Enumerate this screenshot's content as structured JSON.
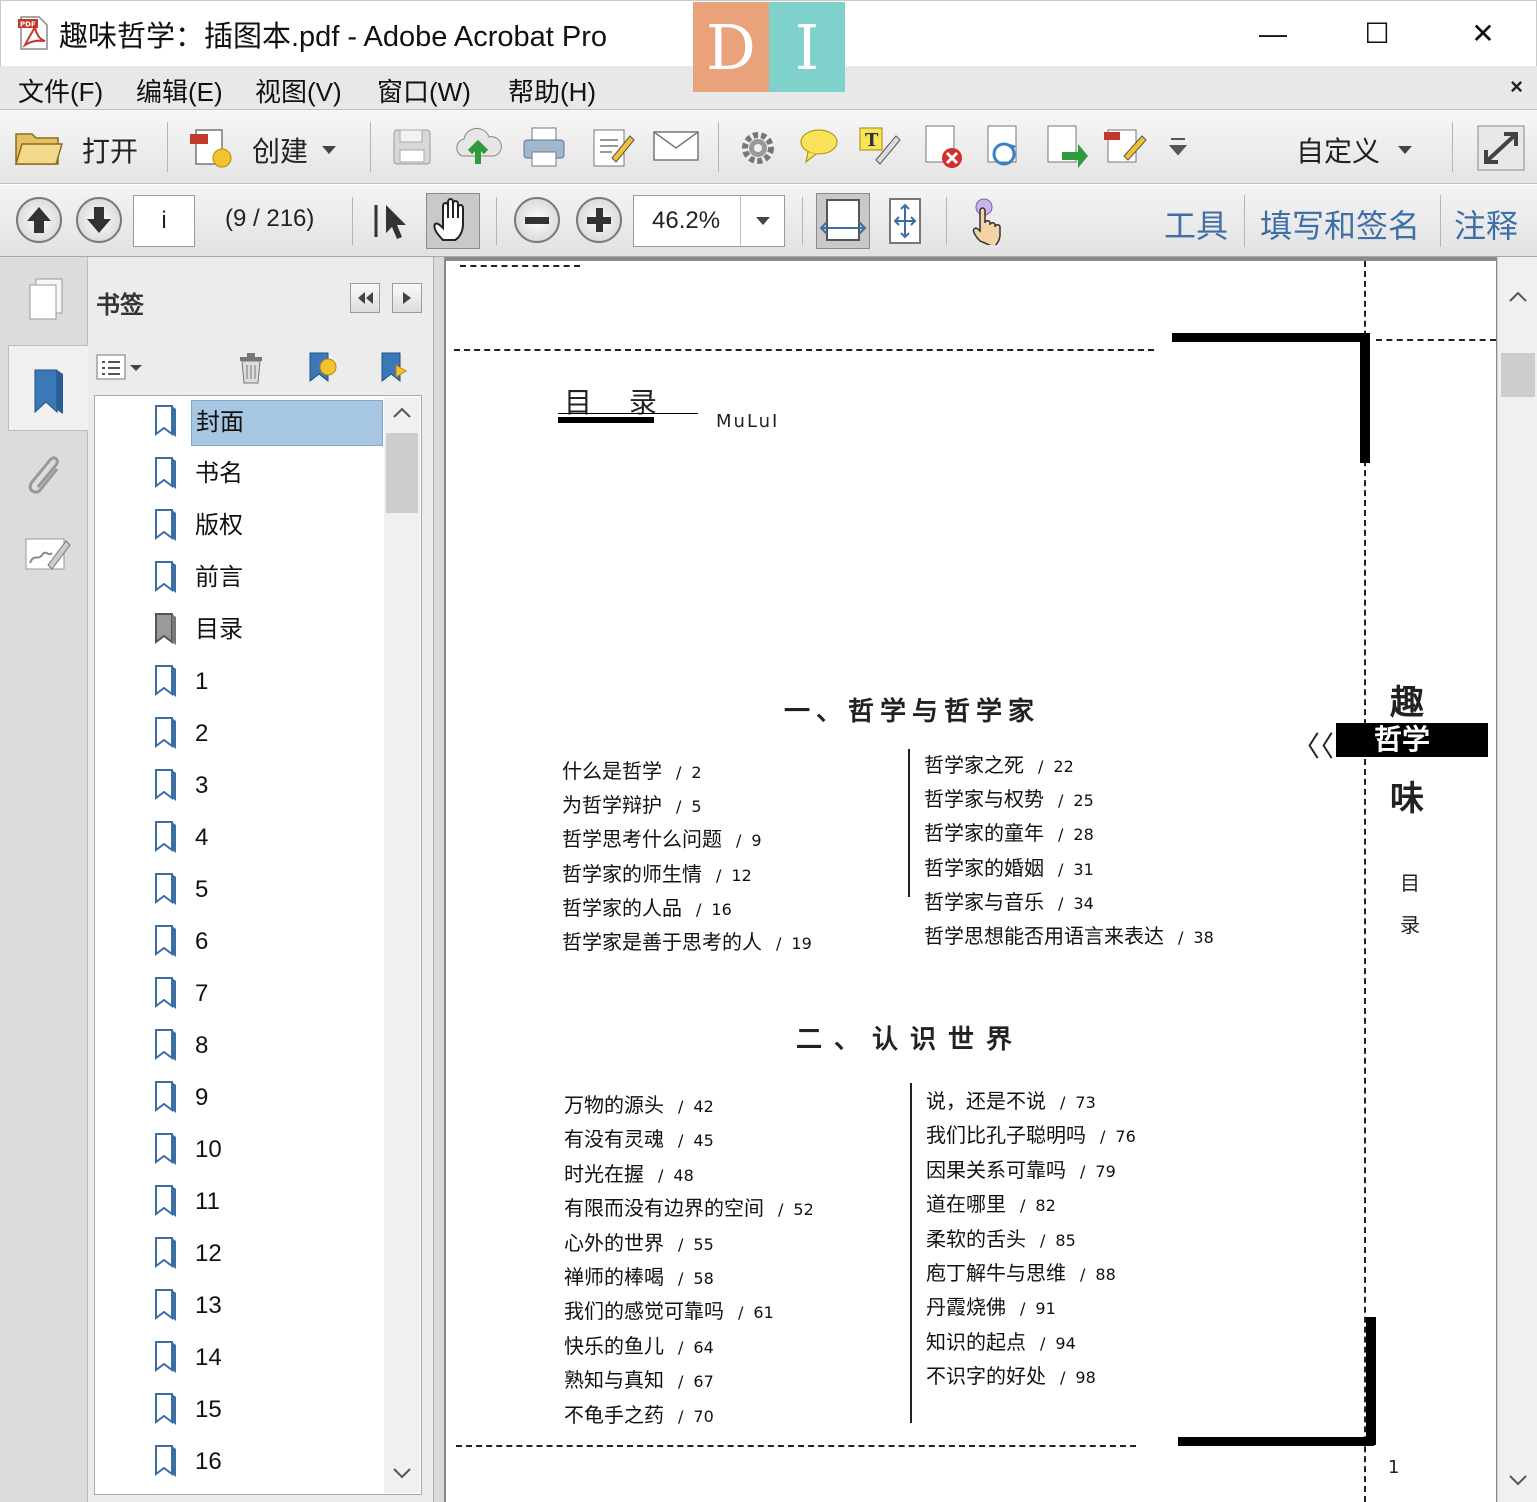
{
  "window": {
    "title": "趣味哲学：插图本.pdf - Adobe Acrobat Pro",
    "watermark": [
      "D",
      "I"
    ],
    "controls": [
      "—",
      "☐",
      "✕"
    ]
  },
  "menu": {
    "items": [
      "文件(F)",
      "编辑(E)",
      "视图(V)",
      "窗口(W)",
      "帮助(H)"
    ],
    "close_glyph": "×"
  },
  "toolbar": {
    "open_label": "打开",
    "create_label": "创建",
    "customize_label": "自定义",
    "icons": [
      "save-icon",
      "cloud-upload-icon",
      "print-icon",
      "edit-document-icon",
      "email-icon",
      "settings-icon",
      "comment-icon",
      "typewriter-icon",
      "delete-page-icon",
      "rotate-icon",
      "extract-page-icon",
      "edit-pen-icon",
      "more-icon",
      "fullscreen-icon"
    ]
  },
  "navbar": {
    "page_input": "i",
    "page_count": "(9 / 216)",
    "zoom_value": "46.2%",
    "tools_label": "工具",
    "fill_sign_label": "填写和签名",
    "comment_label": "注释"
  },
  "bookmarks": {
    "header": "书签",
    "items": [
      "封面",
      "书名",
      "版权",
      "前言",
      "目录",
      "1",
      "2",
      "3",
      "4",
      "5",
      "6",
      "7",
      "8",
      "9",
      "10",
      "11",
      "12",
      "13",
      "14",
      "15",
      "16"
    ],
    "selected": 0
  },
  "document": {
    "toc_title": "目 录",
    "toc_sub": "MuLuI",
    "side_title": [
      "趣",
      "哲学",
      "味"
    ],
    "side_arrows": "〈〈",
    "side_label": [
      "目",
      "录"
    ],
    "page_number": "1",
    "section1": {
      "heading": "一、哲学与哲学家",
      "left": [
        {
          "t": "什么是哲学",
          "p": "2"
        },
        {
          "t": "为哲学辩护",
          "p": "5"
        },
        {
          "t": "哲学思考什么问题",
          "p": "9"
        },
        {
          "t": "哲学家的师生情",
          "p": "12"
        },
        {
          "t": "哲学家的人品",
          "p": "16"
        },
        {
          "t": "哲学家是善于思考的人",
          "p": "19"
        }
      ],
      "right": [
        {
          "t": "哲学家之死",
          "p": "22"
        },
        {
          "t": "哲学家与权势",
          "p": "25"
        },
        {
          "t": "哲学家的童年",
          "p": "28"
        },
        {
          "t": "哲学家的婚姻",
          "p": "31"
        },
        {
          "t": "哲学家与音乐",
          "p": "34"
        },
        {
          "t": "哲学思想能否用语言来表达",
          "p": "38"
        }
      ]
    },
    "section2": {
      "heading": "二、认识世界",
      "left": [
        {
          "t": "万物的源头",
          "p": "42"
        },
        {
          "t": "有没有灵魂",
          "p": "45"
        },
        {
          "t": "时光在握",
          "p": "48"
        },
        {
          "t": "有限而没有边界的空间",
          "p": "52"
        },
        {
          "t": "心外的世界",
          "p": "55"
        },
        {
          "t": "禅师的棒喝",
          "p": "58"
        },
        {
          "t": "我们的感觉可靠吗",
          "p": "61"
        },
        {
          "t": "快乐的鱼儿",
          "p": "64"
        },
        {
          "t": "熟知与真知",
          "p": "67"
        },
        {
          "t": "不龟手之药",
          "p": "70"
        }
      ],
      "right": [
        {
          "t": "说，还是不说",
          "p": "73"
        },
        {
          "t": "我们比孔子聪明吗",
          "p": "76"
        },
        {
          "t": "因果关系可靠吗",
          "p": "79"
        },
        {
          "t": "道在哪里",
          "p": "82"
        },
        {
          "t": "柔软的舌头",
          "p": "85"
        },
        {
          "t": "庖丁解牛与思维",
          "p": "88"
        },
        {
          "t": "丹霞烧佛",
          "p": "91"
        },
        {
          "t": "知识的起点",
          "p": "94"
        },
        {
          "t": "不识字的好处",
          "p": "98"
        }
      ]
    }
  }
}
